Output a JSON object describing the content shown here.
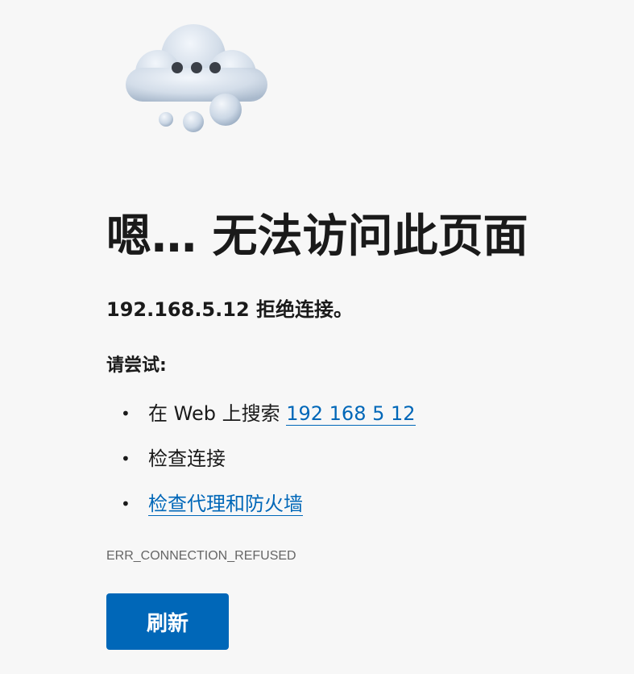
{
  "page": {
    "title": "嗯… 无法访问此页面",
    "subtitle": "192.168.5.12 拒绝连接。",
    "try_heading": "请尝试:",
    "illustration_icon": "thinking-cloud-icon"
  },
  "suggestions": {
    "search_prefix": "在 Web 上搜索 ",
    "search_link": "192 168 5 12",
    "check_connection": "检查连接",
    "check_proxy_link": "检查代理和防火墙"
  },
  "bullet": "•",
  "error_code": "ERR_CONNECTION_REFUSED",
  "refresh_button": "刷新",
  "colors": {
    "background": "#f7f7f7",
    "link": "#0067b8",
    "button": "#0067b8",
    "text": "#1a1a1a",
    "error_code": "#666666"
  }
}
